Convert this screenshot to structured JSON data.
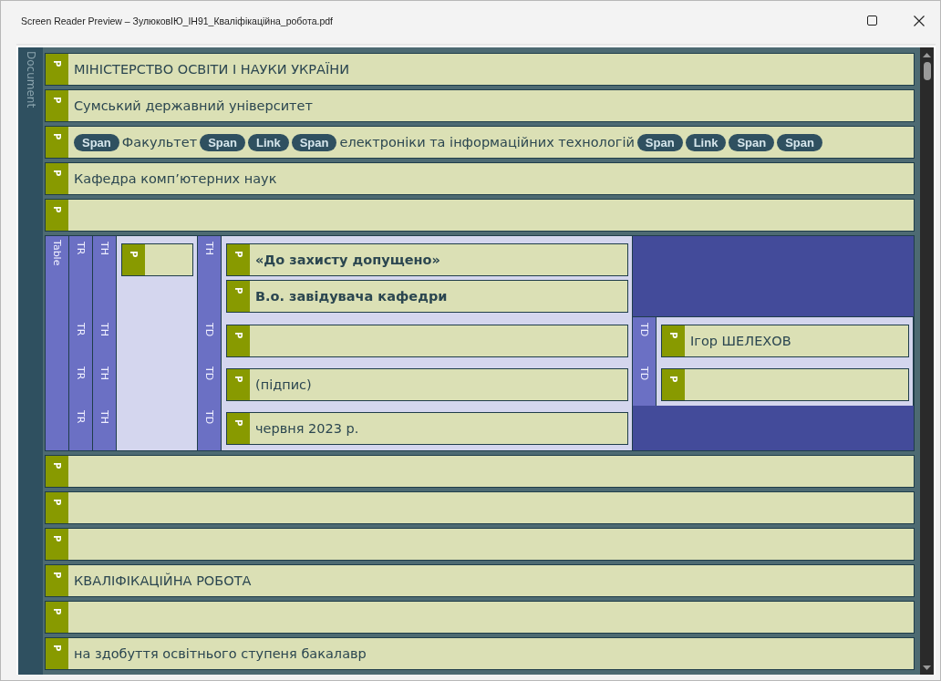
{
  "window": {
    "title": "Screen Reader Preview – ЗулюковІЮ_ІН91_Кваліфікаційна_робота.pdf"
  },
  "document": {
    "tag": "Document",
    "blocks": [
      {
        "kind": "paragraph",
        "tag": "P",
        "text": "МІНІСТЕРСТВО ОСВІТИ І НАУКИ УКРАЇНИ",
        "bold": false
      },
      {
        "kind": "paragraph",
        "tag": "P",
        "text": "Сумський державний університет",
        "bold": false
      },
      {
        "kind": "paragraph",
        "tag": "P",
        "items": [
          {
            "kind": "tag",
            "text": "Span"
          },
          {
            "kind": "text",
            "text": "Факультет"
          },
          {
            "kind": "tag",
            "text": "Span"
          },
          {
            "kind": "tag",
            "text": "Link"
          },
          {
            "kind": "tag",
            "text": "Span"
          },
          {
            "kind": "text",
            "text": "електроніки та інформаційних технологій"
          },
          {
            "kind": "tag",
            "text": "Span"
          },
          {
            "kind": "tag",
            "text": "Link"
          },
          {
            "kind": "tag",
            "text": "Span"
          },
          {
            "kind": "tag",
            "text": "Span"
          }
        ]
      },
      {
        "kind": "paragraph",
        "tag": "P",
        "text": "Кафедра комп’ютерних наук",
        "bold": false
      },
      {
        "kind": "paragraph",
        "tag": "P"
      },
      {
        "kind": "table",
        "tag": "Table",
        "rows": [
          {
            "tag": "TR",
            "cells": [
              {
                "tag": "TH",
                "paragraphs": [
                  {
                    "tag": "P"
                  }
                ]
              },
              {
                "tag": "TH",
                "paragraphs": [
                  {
                    "tag": "P",
                    "text": "«До захисту допущено»",
                    "bold": true
                  },
                  {
                    "tag": "P",
                    "text": "В.о. завідувача кафедри",
                    "bold": true
                  }
                ]
              }
            ]
          },
          {
            "tag": "TR",
            "cells": [
              {
                "tag": "TH"
              },
              {
                "tag": "TD",
                "paragraphs": [
                  {
                    "tag": "P"
                  }
                ]
              },
              {
                "tag": "TD",
                "paragraphs": [
                  {
                    "tag": "P",
                    "text": "Ігор ШЕЛЕХОВ",
                    "bold": false
                  }
                ]
              }
            ]
          },
          {
            "tag": "TR",
            "cells": [
              {
                "tag": "TH"
              },
              {
                "tag": "TD",
                "paragraphs": [
                  {
                    "tag": "P",
                    "text": "(підпис)",
                    "bold": false
                  }
                ]
              },
              {
                "tag": "TD",
                "paragraphs": [
                  {
                    "tag": "P"
                  }
                ]
              }
            ]
          },
          {
            "tag": "TR",
            "cells": [
              {
                "tag": "TH"
              },
              {
                "tag": "TD",
                "paragraphs": [
                  {
                    "tag": "P",
                    "text": "червня 2023 р.",
                    "bold": false
                  }
                ]
              }
            ]
          }
        ]
      },
      {
        "kind": "paragraph",
        "tag": "P"
      },
      {
        "kind": "paragraph",
        "tag": "P"
      },
      {
        "kind": "paragraph",
        "tag": "P"
      },
      {
        "kind": "paragraph",
        "tag": "P",
        "text": "КВАЛІФІКАЦІЙНА РОБОТА",
        "bold": false
      },
      {
        "kind": "paragraph",
        "tag": "P"
      },
      {
        "kind": "paragraph",
        "tag": "P",
        "text": "на здобуття освітнього ступеня бакалавр",
        "bold": false
      }
    ]
  }
}
